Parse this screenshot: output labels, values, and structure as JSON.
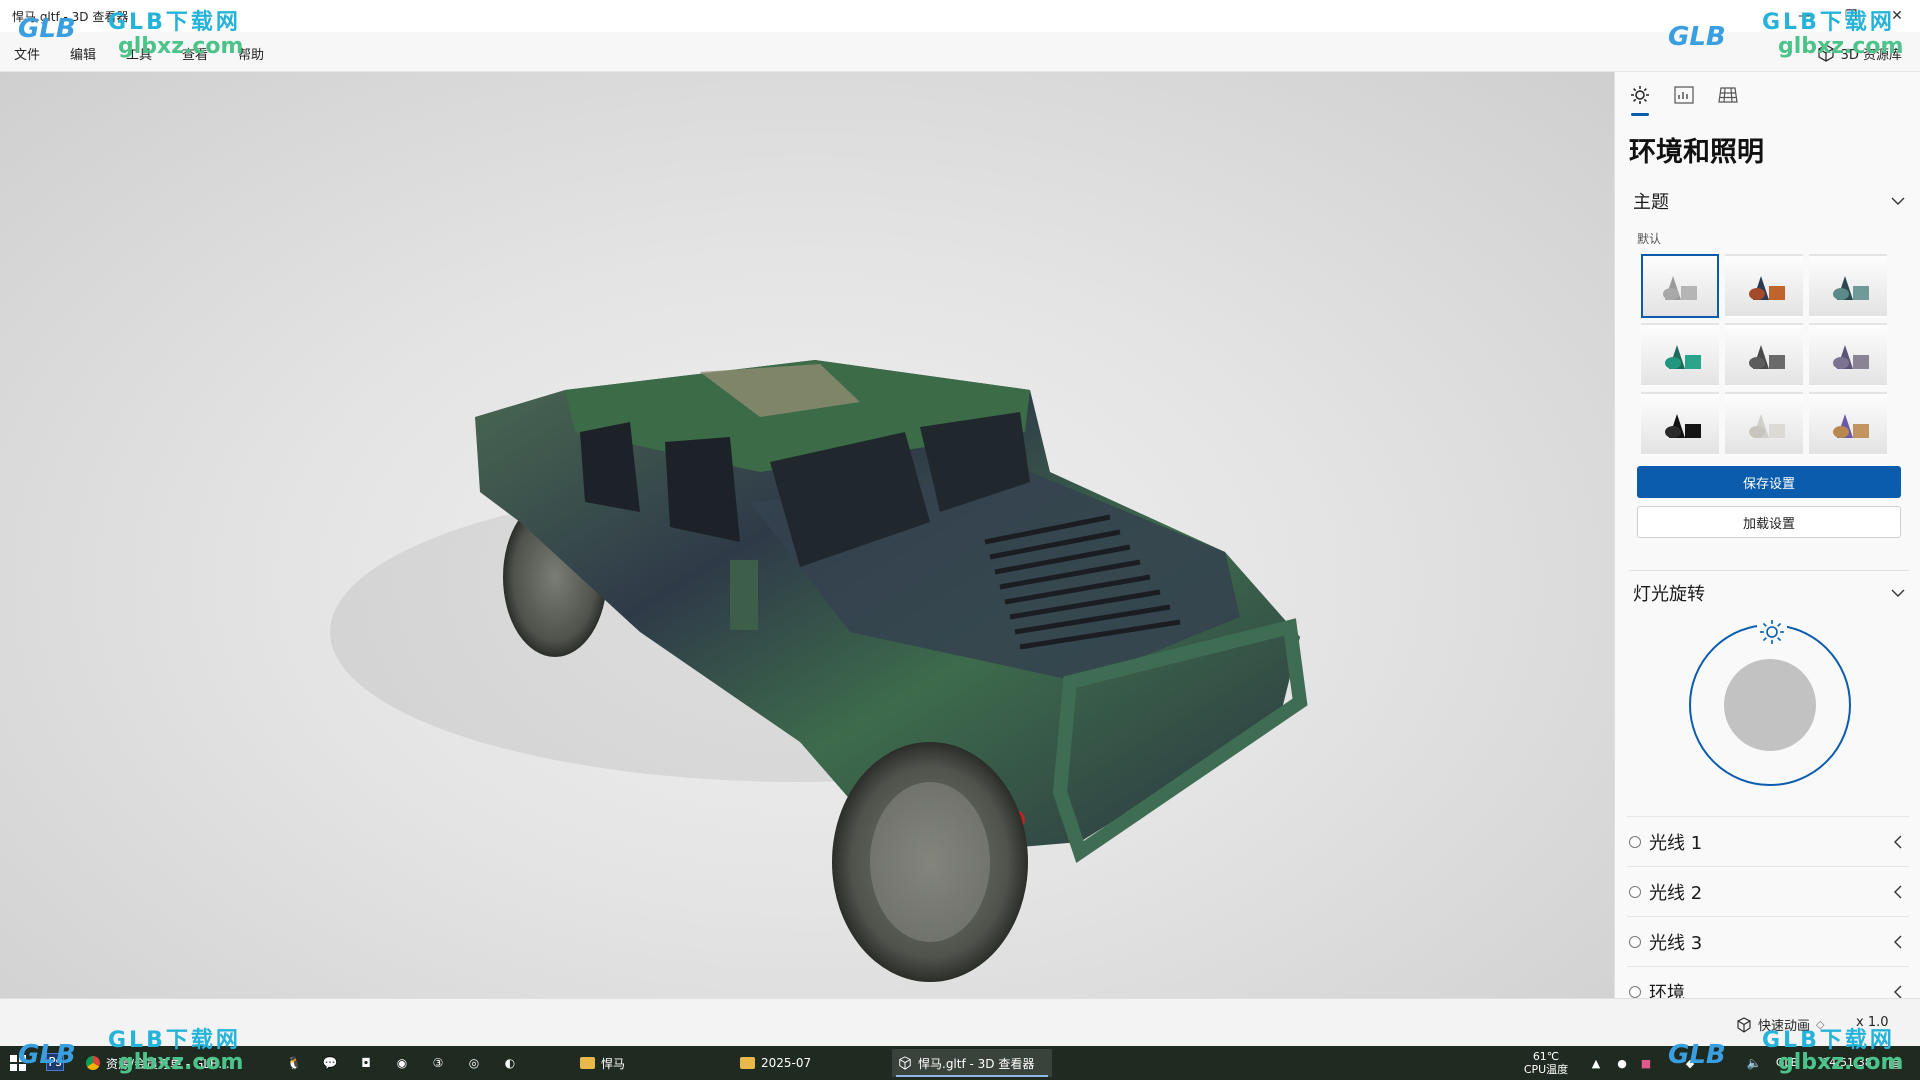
{
  "window": {
    "title": "悍马.gltf - 3D 查看器"
  },
  "menu": {
    "items": [
      "文件",
      "编辑",
      "工具",
      "查看",
      "帮助"
    ],
    "library_label": "3D 资源库"
  },
  "panel": {
    "title": "环境和照明",
    "theme_section": "主题",
    "theme_default_label": "默认",
    "save_button": "保存设置",
    "load_button": "加载设置",
    "rotation_section": "灯光旋转",
    "lights": [
      "光线 1",
      "光线 2",
      "光线 3",
      "环境"
    ]
  },
  "status": {
    "animation_label": "快速动画",
    "speed": "x 1.0"
  },
  "taskbar": {
    "tasks": [
      "资源/会员订单 - GLB...",
      "悍马",
      "2025-07",
      "悍马.gltf - 3D 查看器"
    ],
    "cpu_temp": "61℃",
    "cpu_label": "CPU温度",
    "time": "14:51:38",
    "lang": "GLB"
  },
  "watermark": {
    "logo": "GLB",
    "cn": "GLB下载网",
    "url": "glbxz.com"
  },
  "colors": {
    "accent": "#0b5cad",
    "taskbar": "#1f2a20",
    "watermark_blue": "#3a9fe0",
    "watermark_green": "#4cc38a"
  }
}
